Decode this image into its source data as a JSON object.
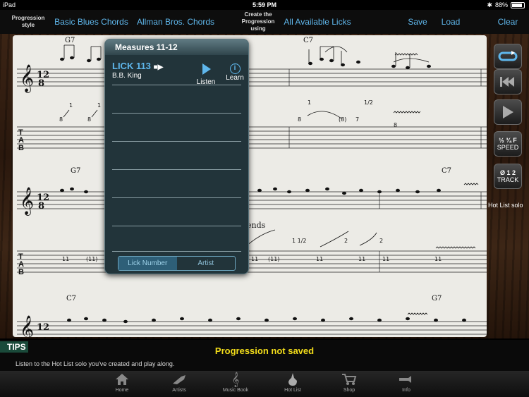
{
  "status": {
    "device": "iPad",
    "time": "5:59 PM",
    "battery": "88%"
  },
  "toolbar": {
    "progression_style": "Progression style",
    "basic_blues": "Basic Blues Chords",
    "allman": "Allman Bros. Chords",
    "create_prog": "Create the Progression using",
    "all_licks": "All Available Licks",
    "save": "Save",
    "load": "Load",
    "clear": "Clear"
  },
  "score": {
    "chords": [
      "G7",
      "C7",
      "G7",
      "C7",
      "C7",
      "G7"
    ],
    "annotation": "ends",
    "speed_label": "SPEED",
    "speed_fraction": "½ ¾ F",
    "track_label": "TRACK",
    "track_nums": "Ø 1 2",
    "hot_list_solo": "Hot List solo"
  },
  "popup": {
    "title": "Measures 11-12",
    "lick_name": "LICK 113",
    "artist": "B.B. King",
    "listen": "Listen",
    "learn": "Learn",
    "seg_lick_number": "Lick Number",
    "seg_artist": "Artist"
  },
  "tips": {
    "tag": "TIPS",
    "message": "Progression not saved",
    "description": "Listen to the Hot List solo you've created and play along."
  },
  "tabs": [
    {
      "label": "Home"
    },
    {
      "label": "Artists"
    },
    {
      "label": "Music Book"
    },
    {
      "label": "Hot List"
    },
    {
      "label": "Shop"
    },
    {
      "label": "Info"
    }
  ],
  "colors": {
    "accent": "#5fb7ec",
    "tip_yellow": "#f3dd1a"
  }
}
